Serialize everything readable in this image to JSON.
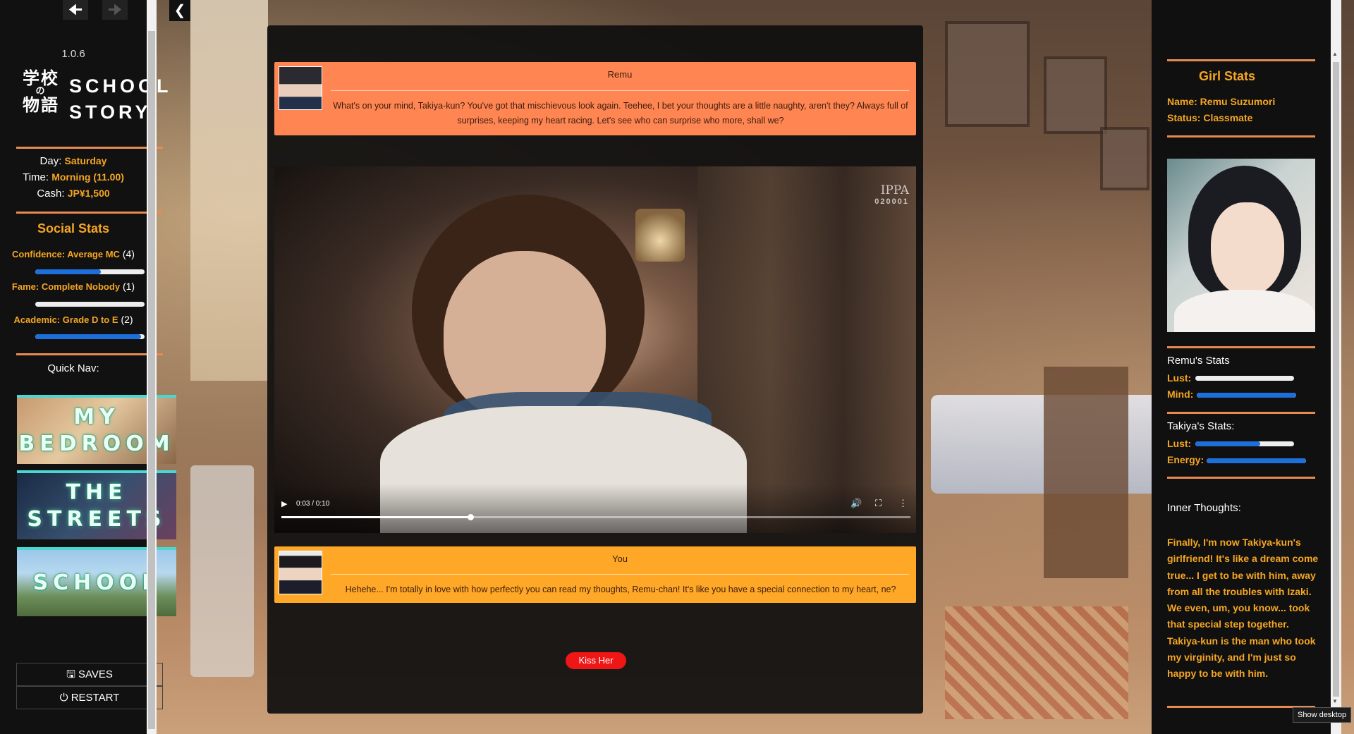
{
  "nav": {
    "back_icon": "arrow-left-icon",
    "forward_icon": "arrow-right-icon",
    "hide_icon": "chevron-left-icon",
    "fullscreen_icon": "square-icon"
  },
  "sidebar": {
    "version": "1.0.6",
    "logo_jp_1": "学校",
    "logo_jp_no": "の",
    "logo_jp_2": "物語",
    "logo_en_1": "SCHOOL",
    "logo_en_2": "STORY",
    "day_label": "Day:",
    "day_value": "Saturday",
    "time_label": "Time:",
    "time_value": "Morning (11.00)",
    "cash_label": "Cash:",
    "cash_value": "JP¥1,500",
    "social_title": "Social Stats",
    "stats": [
      {
        "name": "Confidence: Average MC",
        "level": "(4)",
        "fraction": 0.6
      },
      {
        "name": "Fame: Complete Nobody",
        "level": "(1)",
        "fraction": 0.0
      },
      {
        "name": "Academic: Grade D to E",
        "level": "(2)",
        "fraction": 0.97
      }
    ],
    "quicknav_label": "Quick Nav:",
    "quicknav": [
      {
        "line1": "MY",
        "line2": "BEDROOM"
      },
      {
        "line1": "THE",
        "line2": "STREETS"
      },
      {
        "line1": "SCHOOL",
        "line2": ""
      }
    ],
    "saves_label": "SAVES",
    "restart_label": "RESTART",
    "saves_icon": "save-icon",
    "restart_icon": "power-icon"
  },
  "story": {
    "remu": {
      "speaker": "Remu",
      "text": "What's on your mind, Takiya-kun? You've got that mischievous look again. Teehee, I bet your thoughts are a little naughty, aren't they? Always full of surprises, keeping my heart racing. Let's see who can surprise who more, shall we?"
    },
    "video": {
      "watermark": "IPPA",
      "watermark_code": "020001",
      "time": "0:03 / 0:10",
      "progress": 0.3
    },
    "you": {
      "speaker": "You",
      "text": "Hehehe... I'm totally in love with how perfectly you can read my thoughts, Remu-chan! It's like you have a special connection to my heart, ne?"
    },
    "action_button": "Kiss Her"
  },
  "right": {
    "title": "Girl Stats",
    "name_line": "Name: Remu Suzumori",
    "status_line": "Status: Classmate",
    "remu_stats_title": "Remu's Stats",
    "remu_stats": [
      {
        "label": "Lust:",
        "fraction": 0.0
      },
      {
        "label": "Mind:",
        "fraction": 1.0
      }
    ],
    "takiya_stats_title": "Takiya's Stats:",
    "takiya_stats": [
      {
        "label": "Lust:",
        "fraction": 0.66
      },
      {
        "label": "Energy:",
        "fraction": 1.0
      }
    ],
    "thoughts_title": "Inner Thoughts:",
    "thoughts_text": "Finally, I'm now Takiya-kun's girlfriend! It's like a dream come true... I get to be with him, away from all the troubles with Izaki. We even, um, you know... took that special step together. Takiya-kun is the man who took my virginity, and I'm just so happy to be with him."
  },
  "taskbar_tooltip": "Show desktop"
}
